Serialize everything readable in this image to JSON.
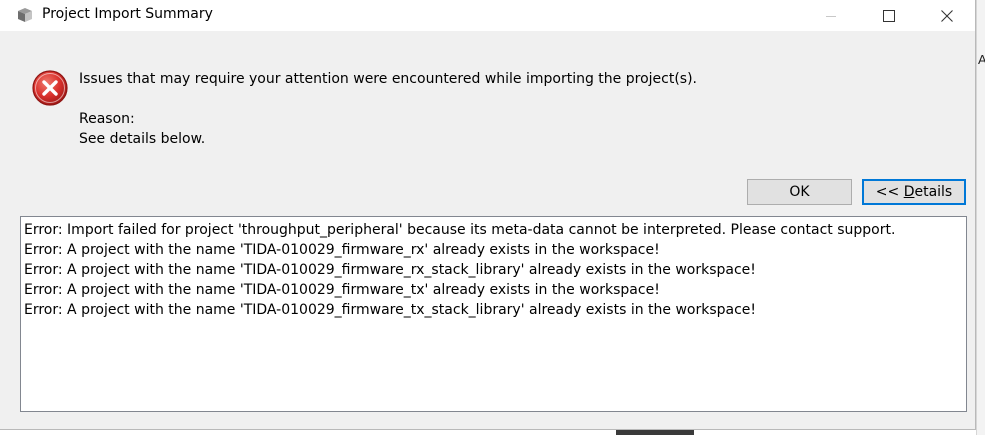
{
  "window": {
    "title": "Project Import Summary"
  },
  "message": {
    "text": "Issues that may require your attention were encountered while importing the project(s).",
    "reason_label": "Reason:",
    "reason_detail": "See details below."
  },
  "buttons": {
    "ok": "OK",
    "details_prefix": "<< ",
    "details_mnemonic": "D",
    "details_rest": "etails"
  },
  "details": {
    "lines": [
      "Error: Import failed for project 'throughput_peripheral' because its meta-data cannot be interpreted. Please contact support.",
      "Error: A project with the name 'TIDA-010029_firmware_rx' already exists in the workspace!",
      "Error: A project with the name 'TIDA-010029_firmware_rx_stack_library' already exists in the workspace!",
      "Error: A project with the name 'TIDA-010029_firmware_tx' already exists in the workspace!",
      "Error: A project with the name 'TIDA-010029_firmware_tx_stack_library' already exists in the workspace!"
    ]
  },
  "background": {
    "edge_char": "A"
  },
  "colors": {
    "focus_border": "#0078d7",
    "error_icon": "#d9302c"
  }
}
